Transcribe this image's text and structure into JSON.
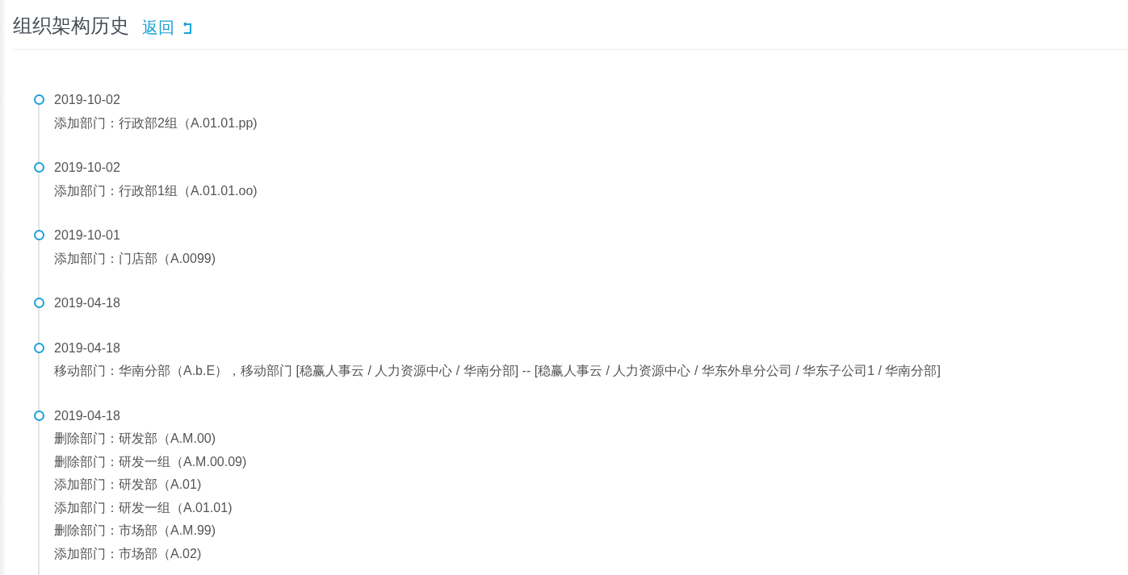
{
  "header": {
    "title": "组织架构历史",
    "back_link": "返回"
  },
  "timeline": [
    {
      "date": "2019-10-02",
      "lines": [
        "添加部门：行政部2组（A.01.01.pp)"
      ]
    },
    {
      "date": "2019-10-02",
      "lines": [
        "添加部门：行政部1组（A.01.01.oo)"
      ]
    },
    {
      "date": "2019-10-01",
      "lines": [
        "添加部门：门店部（A.0099)"
      ]
    },
    {
      "date": "2019-04-18"
    },
    {
      "date": "2019-04-18",
      "lines": [
        "移动部门：华南分部（A.b.E），移动部门 [稳赢人事云 / 人力资源中心 / 华南分部] -- [稳赢人事云 / 人力资源中心 / 华东外阜分公司 / 华东子公司1 / 华南分部]"
      ]
    },
    {
      "date": "2019-04-18",
      "lines": [
        "删除部门：研发部（A.M.00)",
        "删除部门：研发一组（A.M.00.09)",
        "添加部门：研发部（A.01)",
        "添加部门：研发一组（A.01.01)",
        "删除部门：市场部（A.M.99)",
        "添加部门：市场部（A.02)"
      ]
    }
  ]
}
